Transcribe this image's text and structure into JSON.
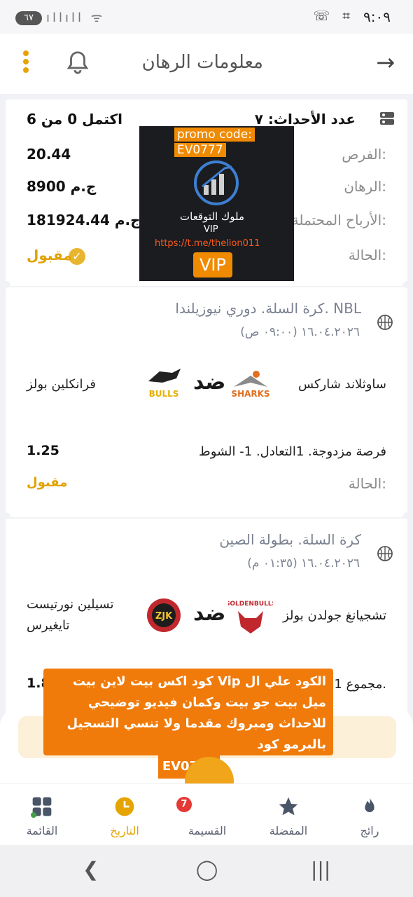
{
  "status_bar": {
    "time": "٩:٠٩",
    "battery": "٦٧"
  },
  "header": {
    "title": "معلومات الرهان"
  },
  "summary": {
    "events_label": "عدد الأحداث: ٧",
    "completed": "اكتمل 0 من 6",
    "odds_label": "الفرص:",
    "odds_value": "20.44",
    "stake_label": "الرهان:",
    "stake_value": "8900 ج.م",
    "potential_label": "الأرباح المحتملة:",
    "potential_value": "181924.44 ج.م",
    "status_label": "الحالة:",
    "status_value": "مقبول"
  },
  "events": [
    {
      "league": "كرة السلة. دوري نيوزيلندا. NBL",
      "datetime": "١٦.٠٤.٢٠٢٦ (٠٩:٠٠ ص)",
      "home": "ساوثلاند شاركس",
      "away": "فرانكلين بولز",
      "vs": "ضد",
      "pick": "فرصة مزدوجة. 1التعادل. 1- الشوط",
      "odd": "1.25",
      "status_label": "الحالة:",
      "status_value": "مقبول"
    },
    {
      "league": "كرة السلة. بطولة الصين",
      "datetime": "١٦.٠٤.٢٠٢٦ (٠١:٣٥ م)",
      "home": "تشجيانغ جولدن بولز",
      "away_line1": "تسيلين نورتيست",
      "away_line2": "تايغيرس",
      "vs": "ضد",
      "pick": "مجموع 1.",
      "odd": "1.8"
    }
  ],
  "promo": {
    "code_line1": "promo code:",
    "code_line2": "EV0777",
    "brand": "ملوك التوقعات",
    "vip_small": "VIP",
    "link": "https://t.me/thelion011",
    "vip_button": "VIP"
  },
  "banner": {
    "text": "الكود علي ال Vip كود اكس بيت لاين بيت ميل بيت جو بيت وكمان فيديو توضيحي للاحداث ومبروك مقدما ولا تنسي التسجيل بالبرمو كود",
    "code": "EV0777"
  },
  "tabs": [
    {
      "label": "رائج",
      "icon": "fire-icon"
    },
    {
      "label": "المفضلة",
      "icon": "star-icon"
    },
    {
      "label": "القسيمة",
      "icon": "coupon-icon",
      "badge": "7"
    },
    {
      "label": "التاريخ",
      "icon": "clock-icon"
    },
    {
      "label": "القائمة",
      "icon": "menu-grid-icon"
    }
  ],
  "colors": {
    "accent": "#e5a400",
    "promo_orange": "#f07b0a",
    "badge_red": "#e53935"
  }
}
